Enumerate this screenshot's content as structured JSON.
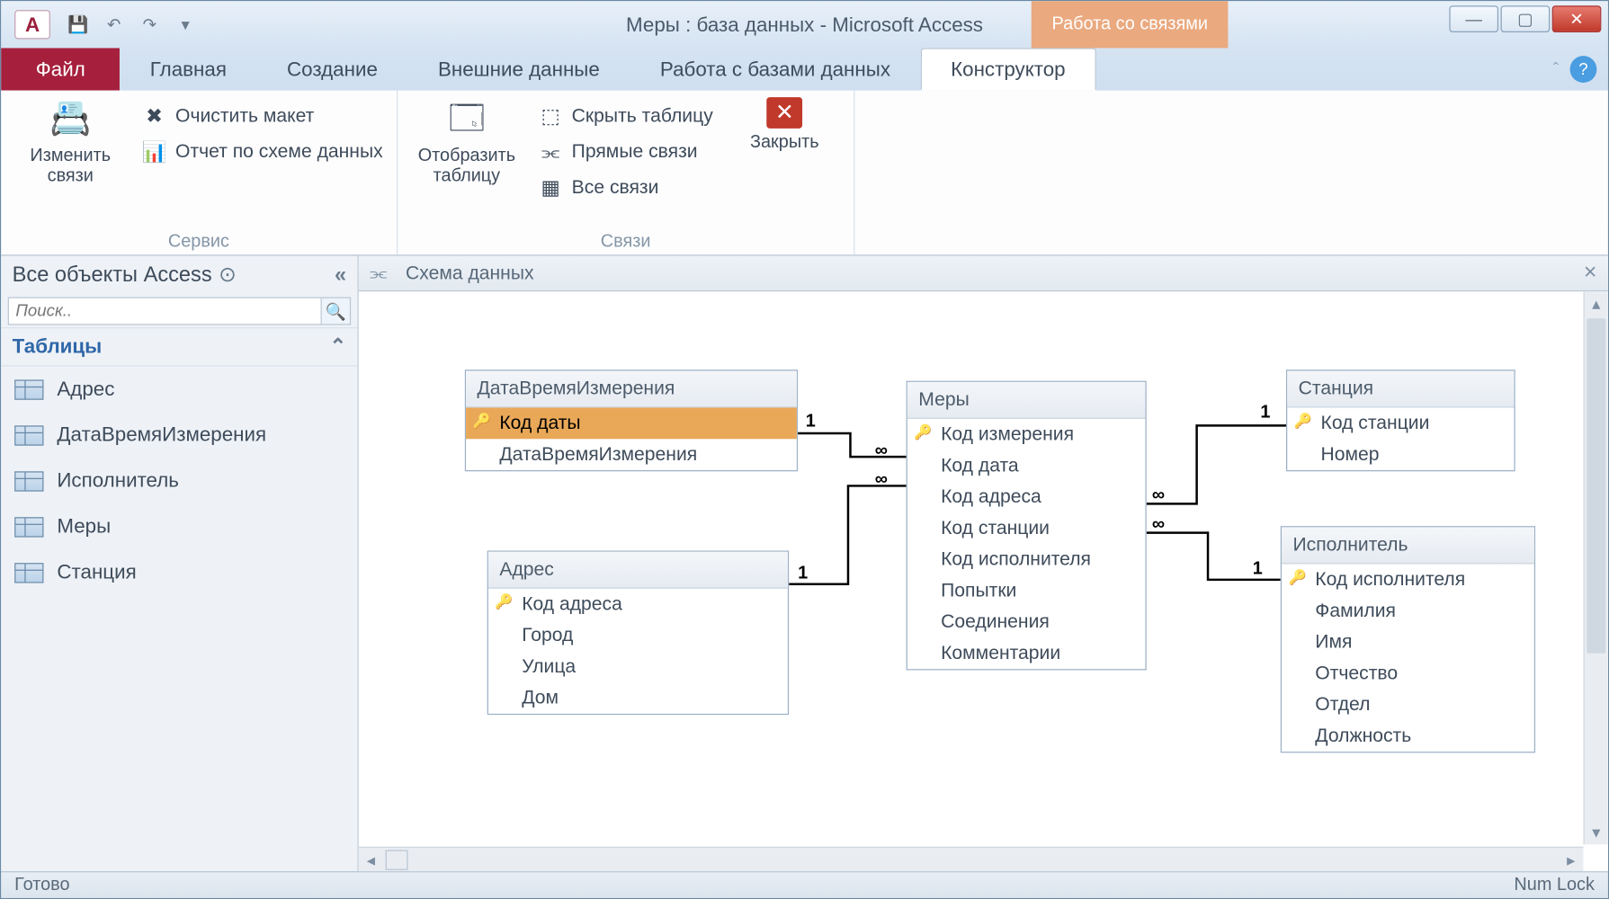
{
  "titlebar": {
    "title": "Меры : база данных  -  Microsoft Access",
    "context_tab": "Работа со связями",
    "app_letter": "А"
  },
  "ribbon_tabs": {
    "file": "Файл",
    "home": "Главная",
    "create": "Создание",
    "external": "Внешние данные",
    "dbtools": "Работа с базами данных",
    "design": "Конструктор"
  },
  "ribbon": {
    "tools_group": "Сервис",
    "rel_group": "Связи",
    "edit_rel": "Изменить связи",
    "clear_layout": "Очистить макет",
    "rel_report": "Отчет по схеме данных",
    "show_table": "Отобразить таблицу",
    "hide_table": "Скрыть таблицу",
    "direct_rel": "Прямые связи",
    "all_rel": "Все связи",
    "close": "Закрыть"
  },
  "nav": {
    "header": "Все объекты Access",
    "search_placeholder": "Поиск..",
    "category": "Таблицы",
    "items": [
      "Адрес",
      "ДатаВремяИзмерения",
      "Исполнитель",
      "Меры",
      "Станция"
    ]
  },
  "doc": {
    "tab_title": "Схема данных"
  },
  "tables": {
    "data_time": {
      "title": "ДатаВремяИзмерения",
      "fields": [
        "Код даты",
        "ДатаВремяИзмерения"
      ],
      "key_idx": 0,
      "sel_idx": 0
    },
    "address": {
      "title": "Адрес",
      "fields": [
        "Код адреса",
        "Город",
        "Улица",
        "Дом"
      ],
      "key_idx": 0
    },
    "measures": {
      "title": "Меры",
      "fields": [
        "Код измерения",
        "Код дата",
        "Код адреса",
        "Код станции",
        "Код исполнителя",
        "Попытки",
        "Соединения",
        "Комментарии"
      ],
      "key_idx": 0
    },
    "station": {
      "title": "Станция",
      "fields": [
        "Код станции",
        "Номер"
      ],
      "key_idx": 0
    },
    "executor": {
      "title": "Исполнитель",
      "fields": [
        "Код исполнителя",
        "Фамилия",
        "Имя",
        "Отчество",
        "Отдел",
        "Должность"
      ],
      "key_idx": 0
    }
  },
  "rel_labels": {
    "one": "1",
    "many": "∞"
  },
  "status": {
    "ready": "Готово",
    "numlock": "Num Lock"
  }
}
